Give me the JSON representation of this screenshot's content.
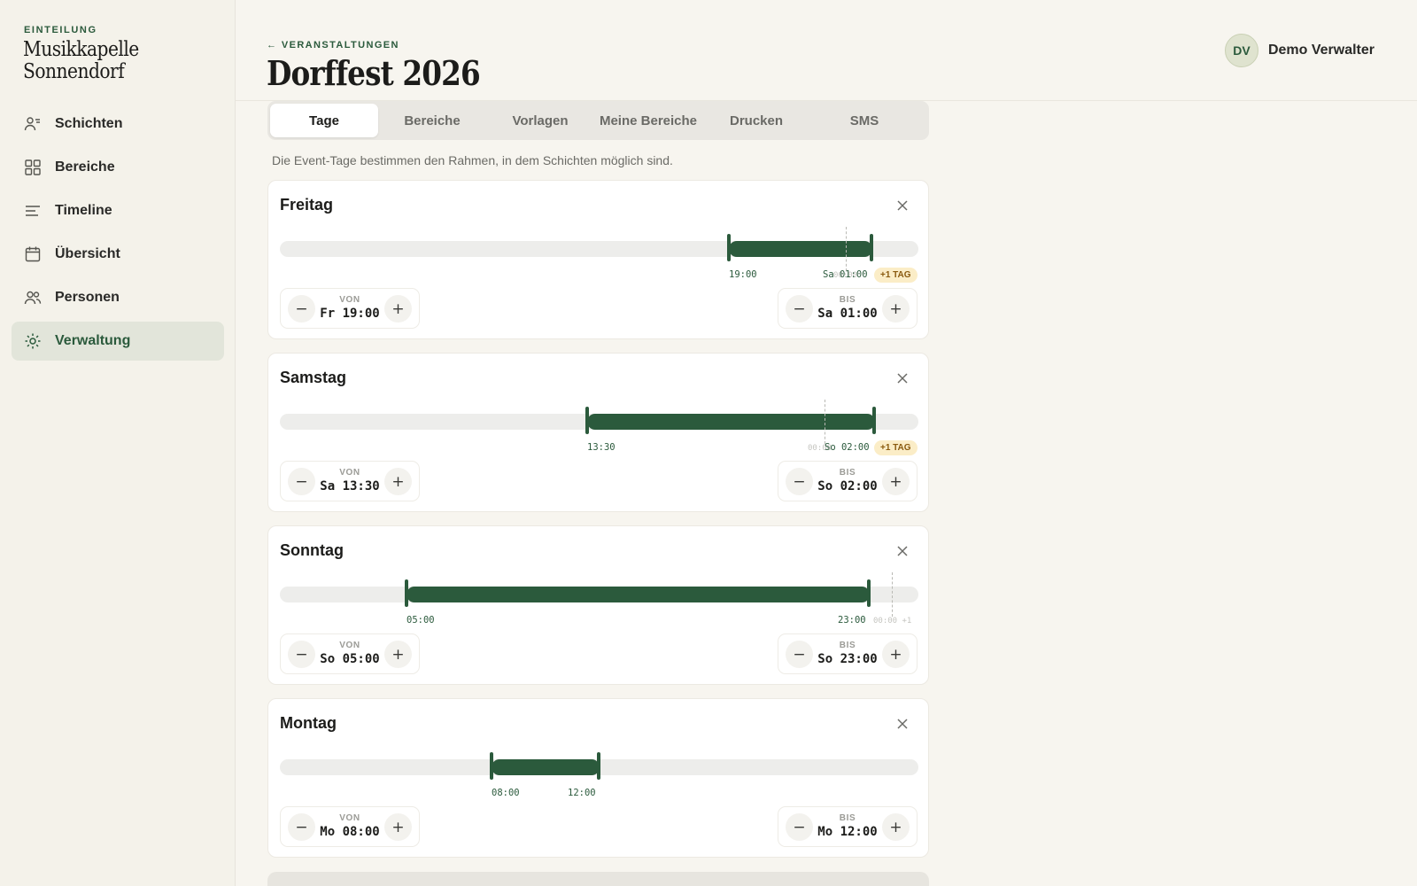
{
  "sidebar": {
    "kicker": "EINTEILUNG",
    "brand_line1": "Musikkapelle",
    "brand_line2": "Sonnendorf",
    "items": [
      {
        "label": "Schichten",
        "icon": "person-list-icon"
      },
      {
        "label": "Bereiche",
        "icon": "grid-icon"
      },
      {
        "label": "Timeline",
        "icon": "lines-icon"
      },
      {
        "label": "Übersicht",
        "icon": "calendar-icon"
      },
      {
        "label": "Personen",
        "icon": "people-icon"
      },
      {
        "label": "Verwaltung",
        "icon": "gear-icon",
        "active": true
      }
    ]
  },
  "header": {
    "back_link": "← VERANSTALTUNGEN",
    "title": "Dorffest 2026",
    "user_initials": "DV",
    "user_name": "Demo Verwalter"
  },
  "tabs": [
    {
      "label": "Tage",
      "active": true
    },
    {
      "label": "Bereiche"
    },
    {
      "label": "Vorlagen"
    },
    {
      "label": "Meine Bereiche"
    },
    {
      "label": "Drucken"
    },
    {
      "label": "SMS"
    }
  ],
  "hint": "Die Event-Tage bestimmen den Rahmen, in dem Schichten möglich sind.",
  "days": [
    {
      "name": "Freitag",
      "start_label": "19:00",
      "end_label": "Sa 01:00",
      "midnight_label": "00:00",
      "badge": "+1 TAG",
      "from_caption": "VON",
      "from_value": "Fr 19:00",
      "to_caption": "BIS",
      "to_value": "Sa 01:00"
    },
    {
      "name": "Samstag",
      "start_label": "13:30",
      "end_label": "So 02:00",
      "midnight_label": "00:00",
      "badge": "+1 TAG",
      "from_caption": "VON",
      "from_value": "Sa 13:30",
      "to_caption": "BIS",
      "to_value": "So 02:00"
    },
    {
      "name": "Sonntag",
      "start_label": "05:00",
      "end_label": "23:00",
      "midnight_label": "00:00 +1",
      "from_caption": "VON",
      "from_value": "So 05:00",
      "to_caption": "BIS",
      "to_value": "So 23:00"
    },
    {
      "name": "Montag",
      "start_label": "08:00",
      "end_label": "12:00",
      "from_caption": "VON",
      "from_value": "Mo 08:00",
      "to_caption": "BIS",
      "to_value": "Mo 12:00"
    }
  ],
  "colors": {
    "accent": "#2b5a3c",
    "badge_bg": "#fbedc7",
    "badge_text": "#8a5a0f",
    "active_nav_bg": "#e2e5da"
  }
}
